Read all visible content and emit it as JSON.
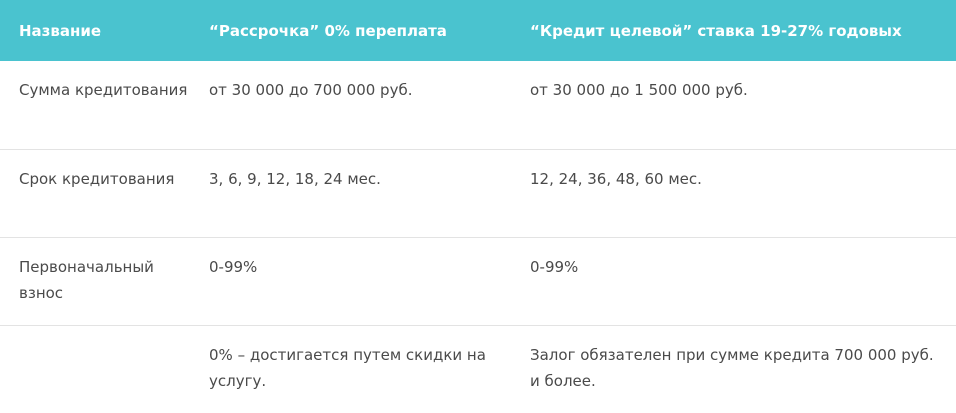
{
  "table": {
    "headers": [
      "Название",
      "“Рассрочка” 0% переплата",
      "“Кредит целевой” ставка 19-27% годовых"
    ],
    "rows": [
      [
        "Сумма кредитования",
        "от 30 000 до 700 000 руб.",
        "от 30 000 до 1 500 000 руб."
      ],
      [
        "Срок кредитования",
        "3, 6, 9, 12, 18, 24 мес.",
        "12, 24, 36, 48, 60 мес."
      ],
      [
        "Первоначальный взнос",
        "0-99%",
        "0-99%"
      ],
      [
        "",
        "0% – достигается путем скидки на услугу.",
        "Залог обязателен при сумме кредита 700 000 руб. и более."
      ]
    ]
  },
  "colors": {
    "header_background": "#4ac3cf",
    "header_text": "#ffffff",
    "body_text": "#4a4a4a",
    "row_divider": "#e3e3e3"
  }
}
